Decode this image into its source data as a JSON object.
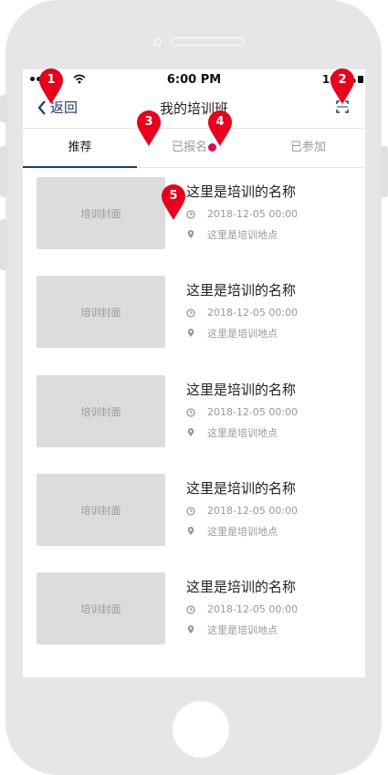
{
  "status": {
    "time": "6:00 PM",
    "battery": "100%"
  },
  "nav": {
    "back_label": "返回",
    "title": "我的培训班"
  },
  "tabs": [
    {
      "label": "推荐",
      "active": true
    },
    {
      "label": "已报名",
      "badge": true
    },
    {
      "label": "已参加"
    }
  ],
  "items": [
    {
      "cover": "培训封面",
      "name": "这里是培训的名称",
      "date": "2018-12-05 00:00",
      "place": "这里是培训地点"
    },
    {
      "cover": "培训封面",
      "name": "这里是培训的名称",
      "date": "2018-12-05 00:00",
      "place": "这里是培训地点"
    },
    {
      "cover": "培训封面",
      "name": "这里是培训的名称",
      "date": "2018-12-05 00:00",
      "place": "这里是培训地点"
    },
    {
      "cover": "培训封面",
      "name": "这里是培训的名称",
      "date": "2018-12-05 00:00",
      "place": "这里是培训地点"
    },
    {
      "cover": "培训封面",
      "name": "这里是培训的名称",
      "date": "2018-12-05 00:00",
      "place": "这里是培训地点"
    }
  ],
  "markers": [
    "1",
    "2",
    "3",
    "4",
    "5"
  ],
  "colors": {
    "accent": "#1c3d6e",
    "badge": "#e5005a",
    "marker": "#e8001c"
  }
}
